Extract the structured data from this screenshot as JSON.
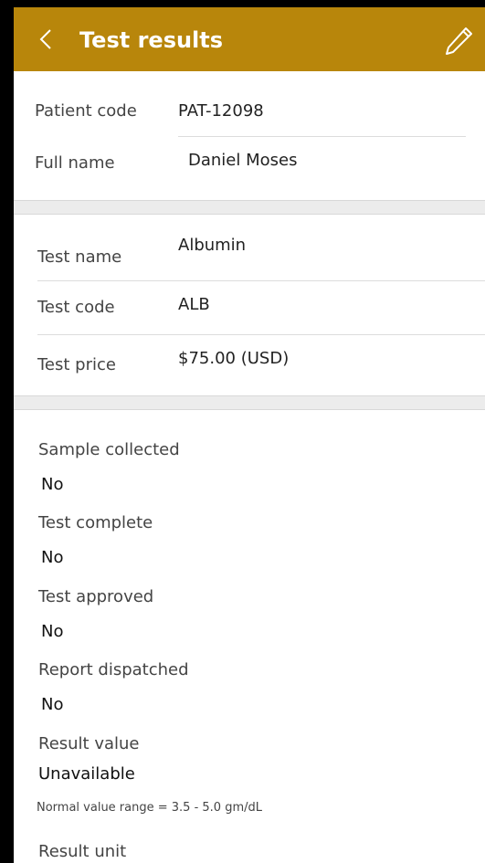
{
  "header": {
    "title": "Test results",
    "back_icon": "chevron-left-icon",
    "edit_icon": "pencil-icon",
    "color": "#b8860b"
  },
  "patient": {
    "code_label": "Patient code",
    "code_value": "PAT-12098",
    "name_label": "Full name",
    "name_value": "Daniel Moses"
  },
  "test": {
    "name_label": "Test name",
    "name_value": "Albumin",
    "code_label": "Test code",
    "code_value": "ALB",
    "price_label": "Test price",
    "price_value": "$75.00 (USD)"
  },
  "status": {
    "sample_label": "Sample collected",
    "sample_value": "No",
    "complete_label": "Test complete",
    "complete_value": "No",
    "approved_label": "Test approved",
    "approved_value": "No",
    "dispatched_label": "Report dispatched",
    "dispatched_value": "No",
    "result_label": "Result value",
    "result_value": "Unavailable",
    "range_note": "Normal value range = 3.5 - 5.0 gm/dL",
    "unit_label": "Result unit"
  }
}
